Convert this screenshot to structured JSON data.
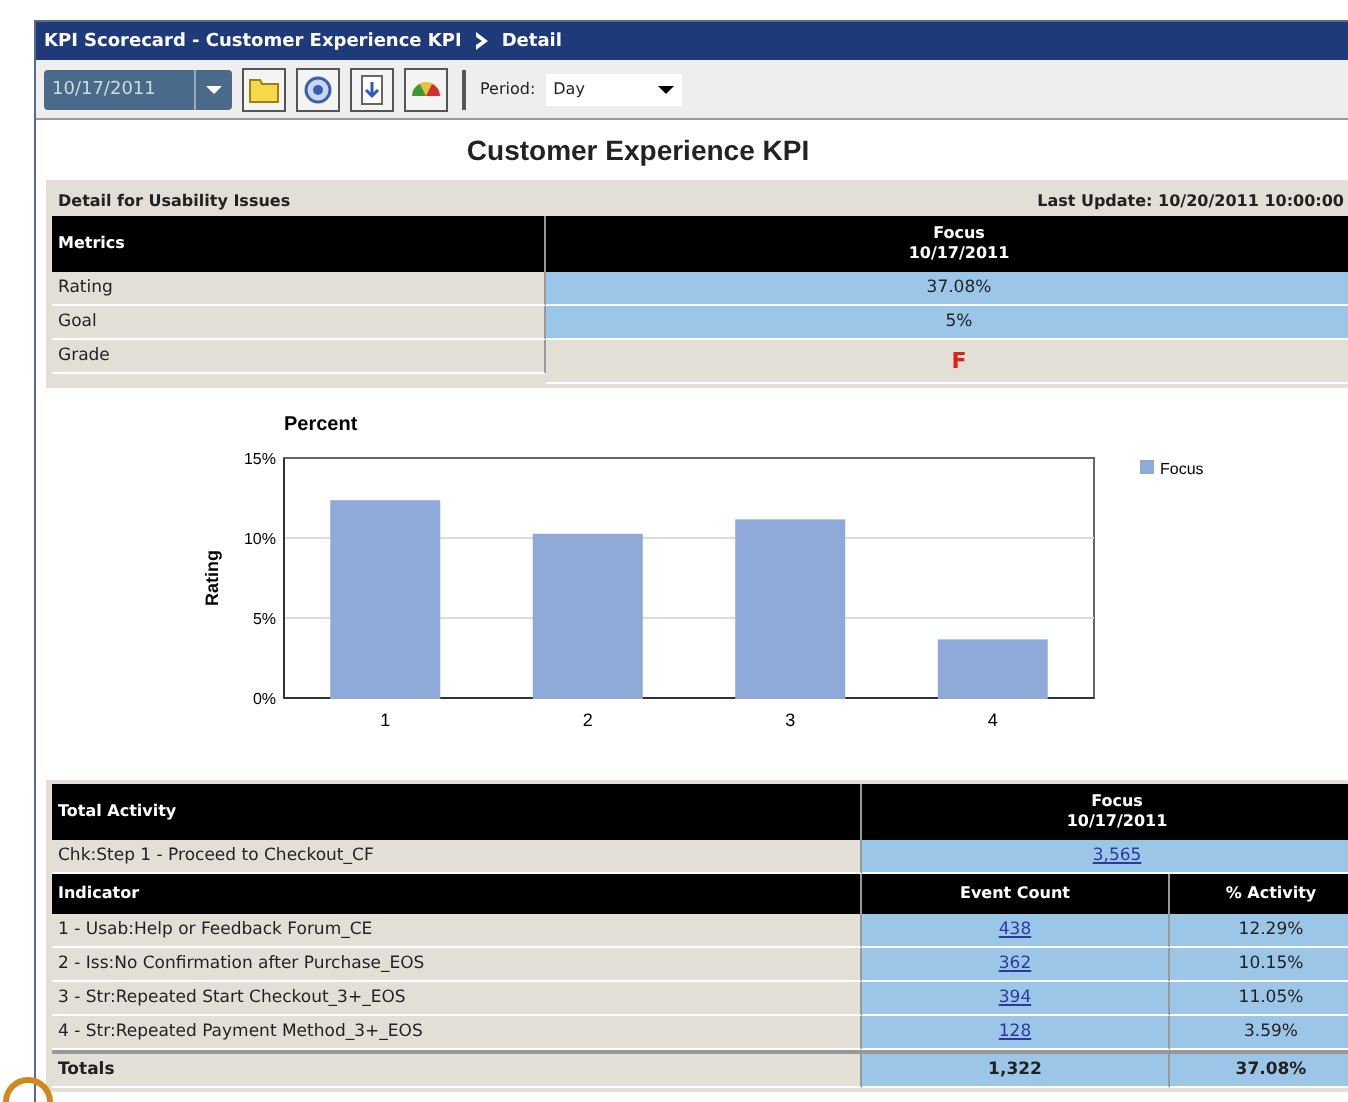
{
  "window": {
    "title": "KPI Scorecard - Customer Experience KPI",
    "crumb": "Detail"
  },
  "toolbar": {
    "date": "10/17/2011",
    "period_label": "Period:",
    "period": "Day"
  },
  "page_title": "Customer Experience KPI",
  "detail": {
    "title": "Detail for Usability Issues",
    "last_update": "Last Update: 10/20/2011 10:00:00",
    "metrics_header": "Metrics",
    "column_header": [
      "Focus",
      "10/17/2011"
    ],
    "rows": [
      {
        "label": "Rating",
        "value": "37.08%",
        "kind": "value"
      },
      {
        "label": "Goal",
        "value": "5%",
        "kind": "value"
      },
      {
        "label": "Grade",
        "value": "F",
        "kind": "grade"
      }
    ]
  },
  "chart": {
    "chart_data": {
      "type": "bar",
      "title": "Percent",
      "ylabel": "Rating",
      "categories": [
        "1",
        "2",
        "3",
        "4"
      ],
      "series": [
        {
          "name": "Focus",
          "color": "#8fa9d8",
          "values": [
            12.3,
            10.2,
            11.1,
            3.6
          ]
        }
      ],
      "ylim": [
        0,
        15
      ],
      "yticks": [
        {
          "value": 0,
          "label": "0%"
        },
        {
          "value": 5,
          "label": "5%"
        },
        {
          "value": 10,
          "label": "10%"
        },
        {
          "value": 15,
          "label": "15%"
        }
      ]
    }
  },
  "activity": {
    "header": "Total Activity",
    "column_header": [
      "Focus",
      "10/17/2011"
    ],
    "base": {
      "label": "Chk:Step 1 - Proceed to Checkout_CF",
      "value": "3,565"
    },
    "columns": [
      "Indicator",
      "Event Count",
      "% Activity"
    ],
    "rows": [
      {
        "label": "1 - Usab:Help or Feedback Forum_CE",
        "count": "438",
        "activity": "12.29%"
      },
      {
        "label": "2 - Iss:No Confirmation after Purchase_EOS",
        "count": "362",
        "activity": "10.15%"
      },
      {
        "label": "3 - Str:Repeated Start Checkout_3+_EOS",
        "count": "394",
        "activity": "11.05%"
      },
      {
        "label": "4 - Str:Repeated Payment Method_3+_EOS",
        "count": "128",
        "activity": "3.59%"
      }
    ],
    "totals": {
      "label": "Totals",
      "count": "1,322",
      "activity": "37.08%"
    }
  }
}
